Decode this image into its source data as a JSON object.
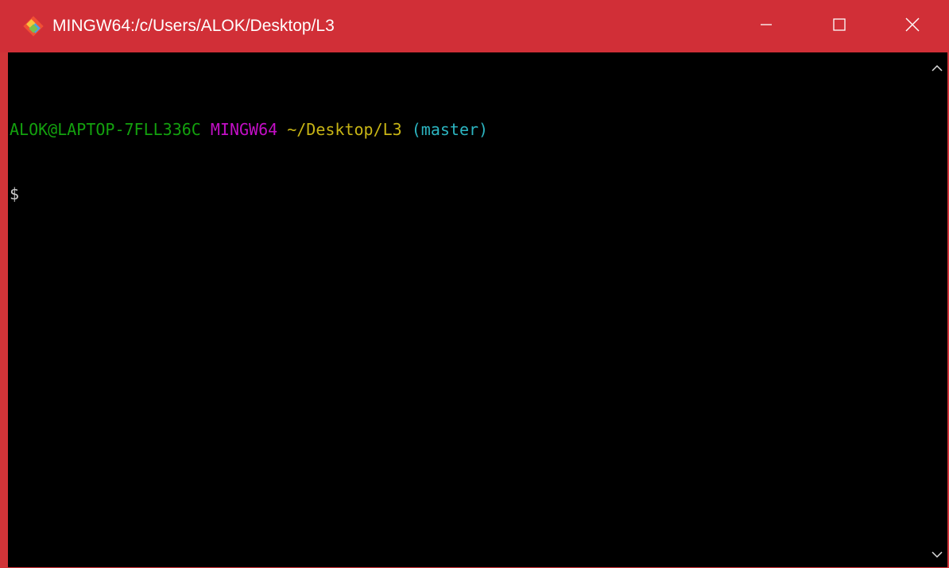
{
  "window": {
    "title": "MINGW64:/c/Users/ALOK/Desktop/L3",
    "icon": "git-bash-icon",
    "controls": [
      "minimize-icon",
      "maximize-icon",
      "close-icon"
    ]
  },
  "terminal": {
    "prompt_line": {
      "user_host": "ALOK@LAPTOP-7FLL336C",
      "system": "MINGW64",
      "path": "~/Desktop/L3",
      "branch": "(master)"
    },
    "prompt_symbol": "$"
  },
  "colors": {
    "titlebar": "#d12f37",
    "background": "#000000",
    "user_host": "#13a10e",
    "system": "#c30fc6",
    "path": "#c8b515",
    "branch": "#2cb5c1"
  }
}
